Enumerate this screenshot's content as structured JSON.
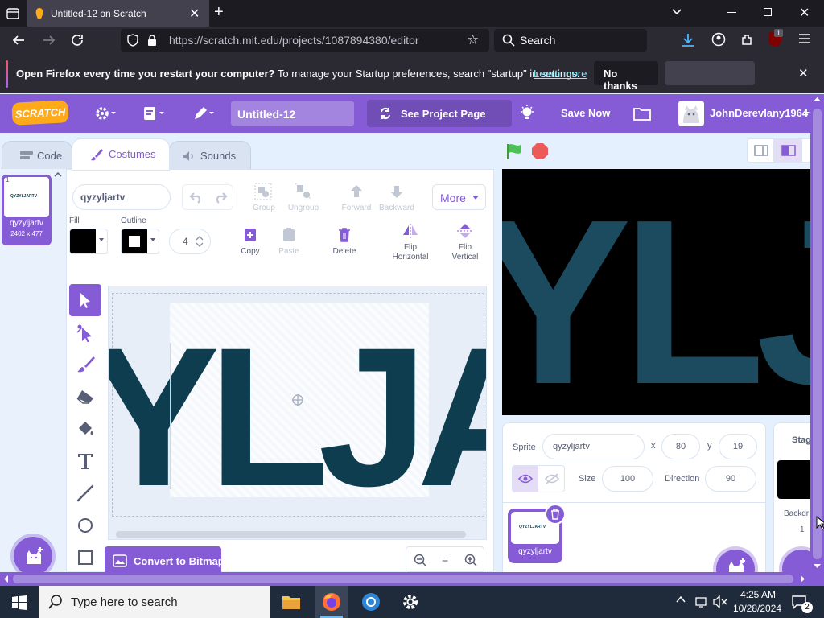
{
  "browser": {
    "tab_title": "Untitled-12 on Scratch",
    "url": "https://scratch.mit.edu/projects/1087894380/editor",
    "url_host": "scratch.mit.edu",
    "search_placeholder": "Search",
    "ext_badge": "1"
  },
  "notification": {
    "bold_text": "Open Firefox every time you restart your computer?",
    "text": " To manage your Startup preferences, search \"startup\" in settings.",
    "link": "Learn more",
    "no_thanks": "No thanks"
  },
  "menubar": {
    "logo": "SCRATCH",
    "project_title": "Untitled-12",
    "see_project": "See Project Page",
    "save_now": "Save Now",
    "username": "JohnDerevlany1964"
  },
  "tabs": {
    "code": "Code",
    "costumes": "Costumes",
    "sounds": "Sounds"
  },
  "costume_list": [
    {
      "index": "1",
      "thumb_text": "QYZYLJARTV",
      "name": "qyzyljartv",
      "size": "2402 x 477"
    }
  ],
  "paint": {
    "costume_name": "qyzyljartv",
    "group": "Group",
    "ungroup": "Ungroup",
    "forward": "Forward",
    "backward": "Backward",
    "more": "More",
    "fill_label": "Fill",
    "outline_label": "Outline",
    "outline_width": "4",
    "copy": "Copy",
    "paste": "Paste",
    "delete": "Delete",
    "flip_h": "Flip\nHorizontal",
    "flip_v": "Flip\nVertical",
    "canvas_text": "YLJA",
    "convert_bitmap": "Convert to Bitmap",
    "zoom_reset": "="
  },
  "stage_view": {
    "text": "YLJ"
  },
  "sprite_info": {
    "sprite_label": "Sprite",
    "sprite_name": "qyzyljartv",
    "x_label": "x",
    "x": "80",
    "y_label": "y",
    "y": "19",
    "size_label": "Size",
    "size": "100",
    "direction_label": "Direction",
    "direction": "90"
  },
  "sprite_tile": {
    "thumb_text": "QYZYLJARTV",
    "name": "qyzyljartv"
  },
  "stage_pane": {
    "label": "Stage",
    "backdrops_label": "Backdr",
    "backdrops_count": "1"
  },
  "taskbar": {
    "search_placeholder": "Type here to search",
    "time": "4:25 AM",
    "date": "10/28/2024",
    "notif_count": "2"
  },
  "colors": {
    "scratch_purple": "#855cd6",
    "letters": "#0e3d4f",
    "stage_letters": "#1c4a5e",
    "green_flag": "#4cbf56",
    "stop": "#ec5959"
  }
}
